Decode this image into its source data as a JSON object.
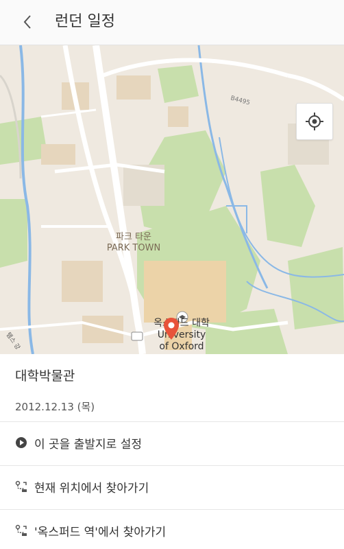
{
  "header": {
    "title": "런던 일정",
    "back_icon": "chevron-left-icon"
  },
  "map": {
    "labels": {
      "park_town_ko": "파크 타운",
      "park_town_en": "PARK TOWN",
      "oxford_ko": "옥스퍼드 대학",
      "oxford_en_1": "University",
      "oxford_en_2": "of Oxford",
      "road_b4495": "B4495",
      "left_road": "템스 강"
    },
    "colors": {
      "land": "#efe9e0",
      "green": "#c8dfac",
      "water": "#8ab8e6",
      "road": "#ffffff",
      "building": "#e6d6bd",
      "pin": "#e8533a"
    }
  },
  "place": {
    "name": "대학박물관",
    "date": "2012.12.13 (목)"
  },
  "actions": [
    {
      "label": "이 곳을 출발지로 설정",
      "icon": "play-circle-icon"
    },
    {
      "label": "현재 위치에서 찾아가기",
      "icon": "route-icon"
    },
    {
      "label": "'옥스퍼드 역'에서 찾아가기",
      "icon": "route-icon"
    }
  ]
}
